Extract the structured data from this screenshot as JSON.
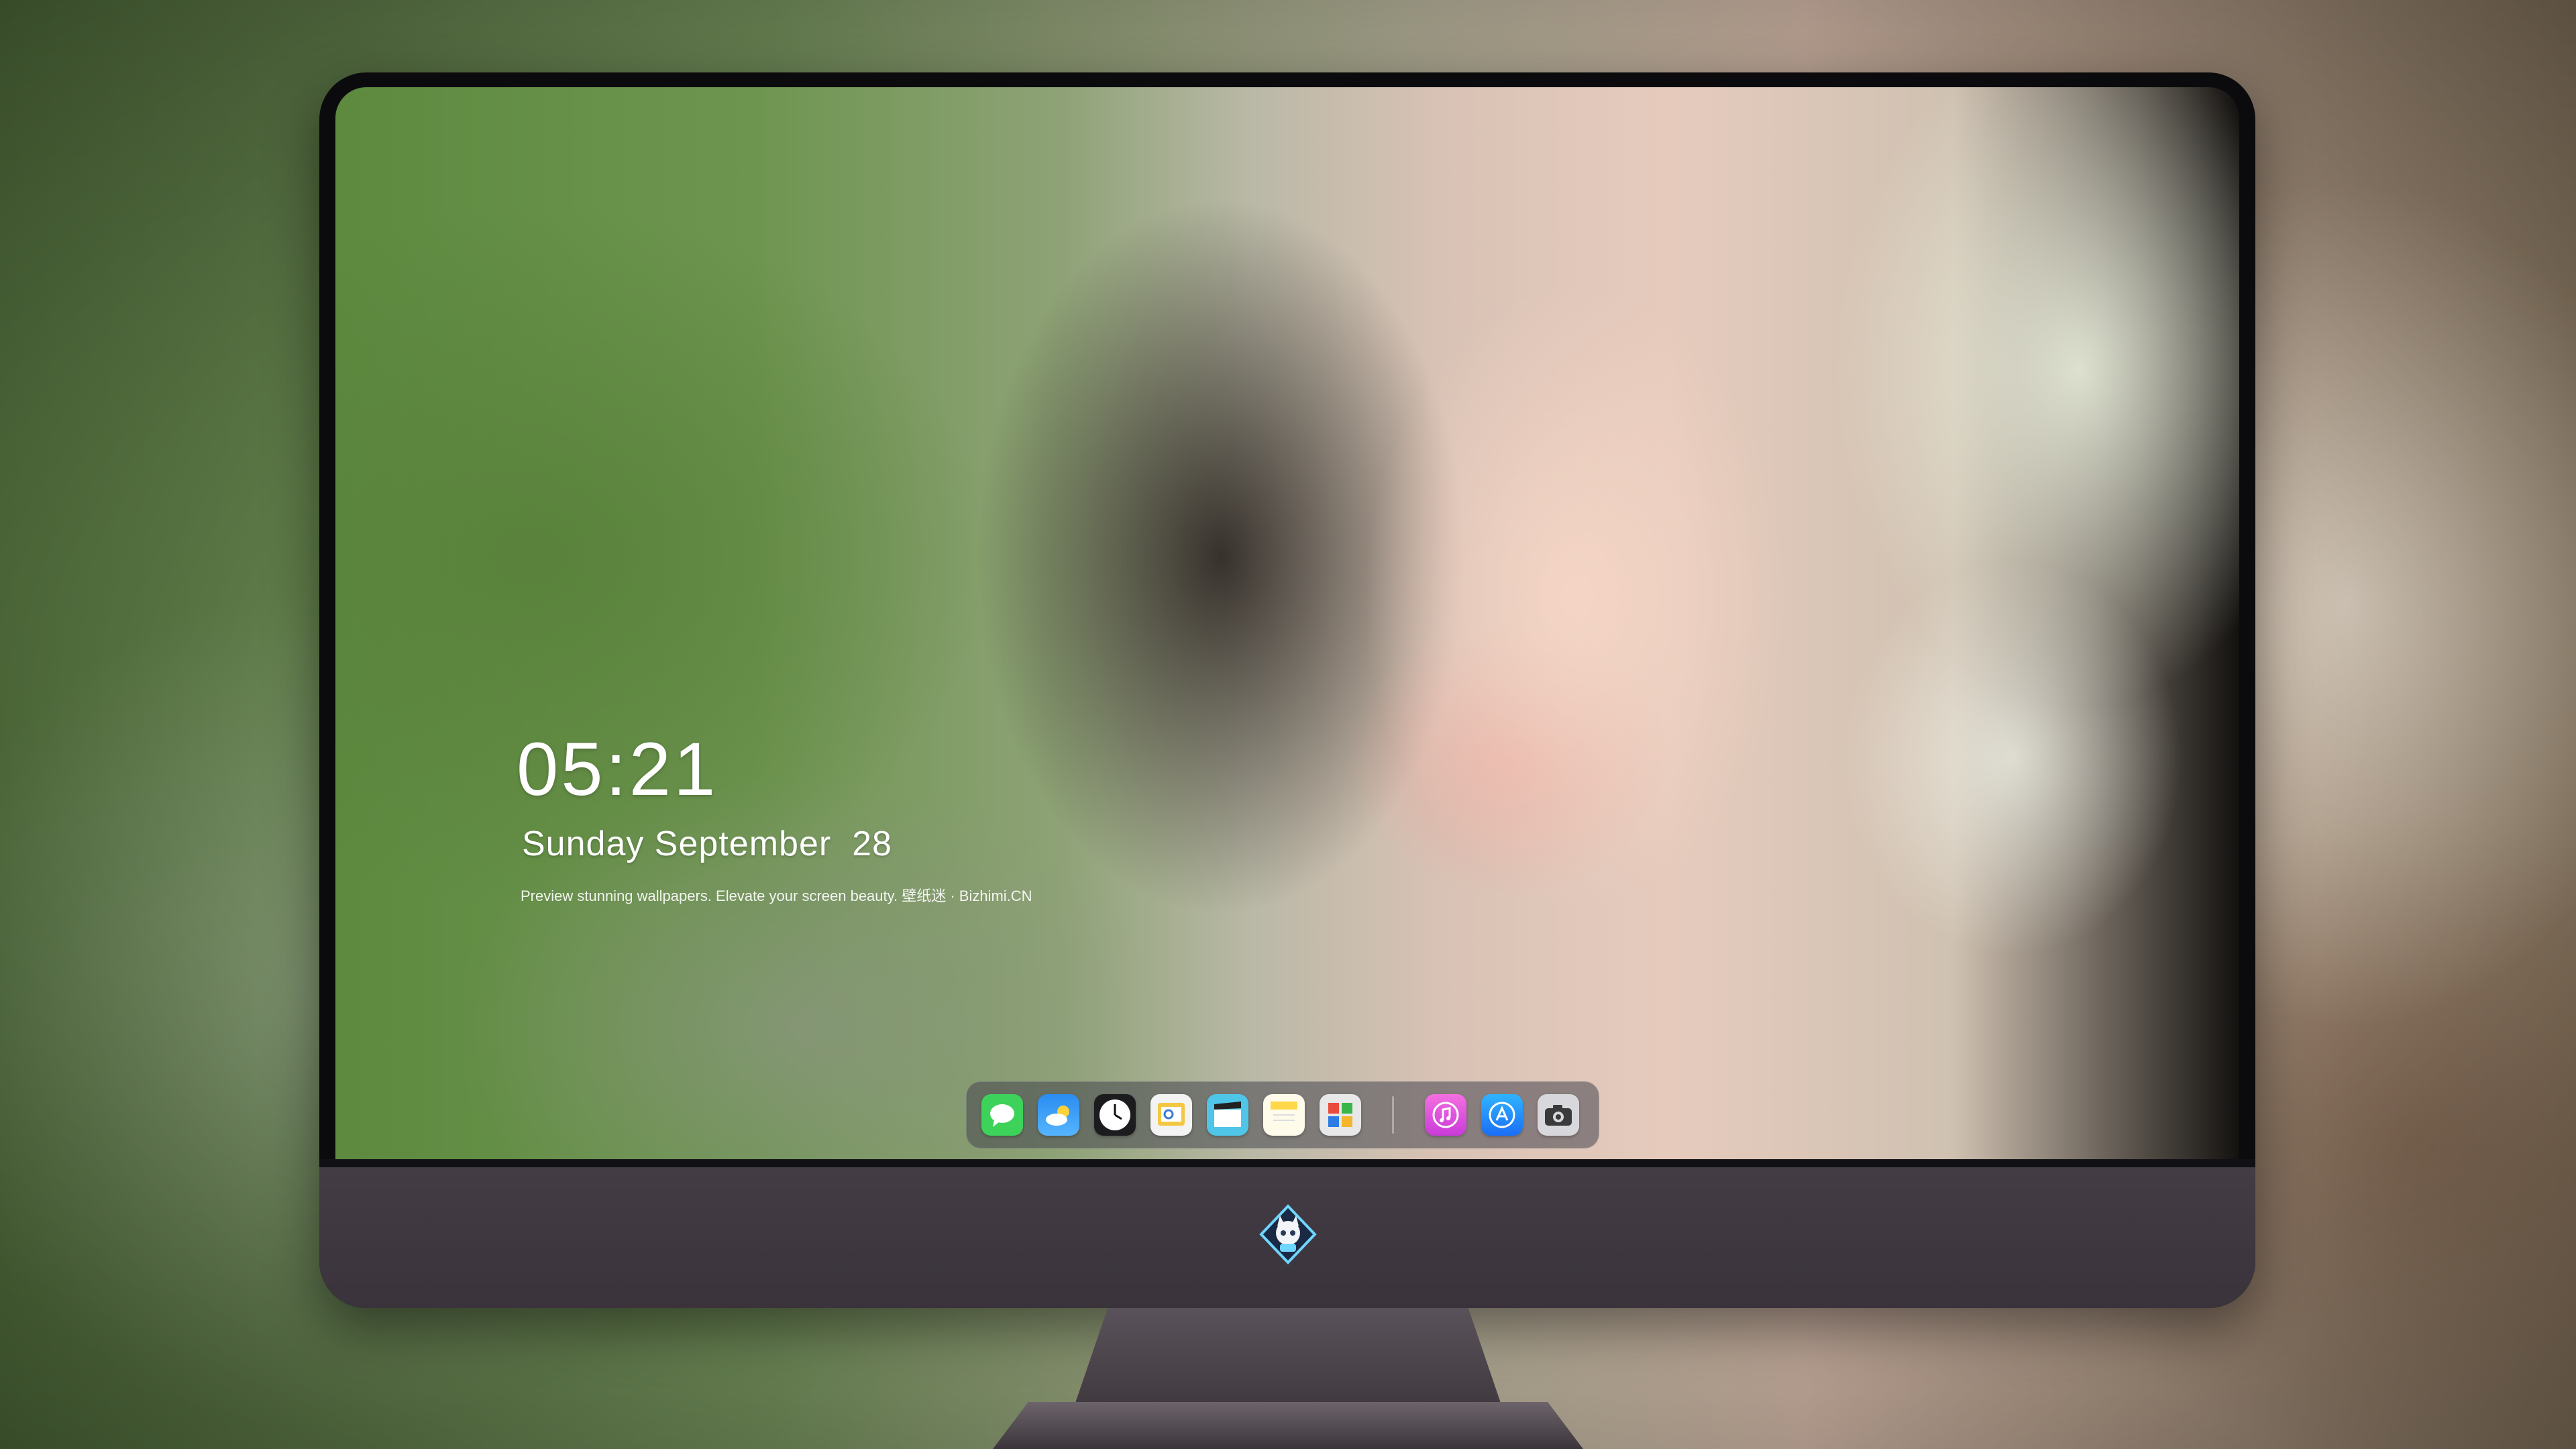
{
  "lockscreen": {
    "time": "05:21",
    "date": "Sunday September  28",
    "tagline": "Preview stunning wallpapers. Elevate your screen beauty. 壁纸迷 · Bizhimi.CN"
  },
  "dock": {
    "apps": [
      {
        "name": "Messages",
        "icon": "messages-icon",
        "color": "#3dd25a"
      },
      {
        "name": "Weather",
        "icon": "weather-icon",
        "color": "#2a8cf0"
      },
      {
        "name": "Clock",
        "icon": "clock-icon",
        "color": "#1c1c1e"
      },
      {
        "name": "Preview",
        "icon": "preview-icon",
        "color": "#f3c742"
      },
      {
        "name": "Video",
        "icon": "clapperboard-icon",
        "color": "#4fc6e8"
      },
      {
        "name": "Notes",
        "icon": "notes-icon",
        "color": "#ffd84a"
      },
      {
        "name": "Photo Booth",
        "icon": "photo-booth-icon",
        "color": "#e8e8e8"
      },
      {
        "name": "Music",
        "icon": "music-icon",
        "color": "#e94bd1"
      },
      {
        "name": "App Store",
        "icon": "app-store-icon",
        "color": "#1b8ef5"
      },
      {
        "name": "Camera",
        "icon": "camera-icon",
        "color": "#8e8e93"
      }
    ]
  },
  "monitor": {
    "bezel_color": "#0b0b0d",
    "chin_color": "#3d363e",
    "logo": "cat-mascot-logo"
  }
}
